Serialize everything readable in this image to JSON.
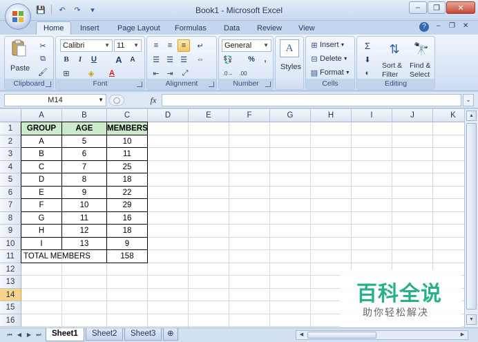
{
  "window": {
    "title": "Book1 - Microsoft Excel",
    "controls": {
      "minimize": "–",
      "restore": "❐",
      "close": "✕"
    }
  },
  "quick_access": {
    "save": "💾",
    "undo": "↶",
    "redo": "↷",
    "customize": "▾"
  },
  "ribbon_tabs": [
    {
      "label": "Home",
      "active": true
    },
    {
      "label": "Insert"
    },
    {
      "label": "Page Layout"
    },
    {
      "label": "Formulas"
    },
    {
      "label": "Data"
    },
    {
      "label": "Review"
    },
    {
      "label": "View"
    }
  ],
  "ribbon": {
    "clipboard": {
      "label": "Clipboard",
      "paste": "Paste"
    },
    "font": {
      "label": "Font",
      "name": "Calibri",
      "size": "11",
      "bold": "B",
      "italic": "I",
      "underline": "U"
    },
    "alignment": {
      "label": "Alignment"
    },
    "number": {
      "label": "Number",
      "format": "General",
      "percent": "%",
      "comma": ","
    },
    "styles": {
      "label": "Styles"
    },
    "cells": {
      "label": "Cells",
      "insert": "Insert",
      "delete": "Delete",
      "format": "Format"
    },
    "editing": {
      "label": "Editing",
      "sort_filter": "Sort &",
      "sort_filter2": "Filter",
      "find_select": "Find &",
      "find_select2": "Select"
    }
  },
  "formula_bar": {
    "name_box": "M14",
    "fx": "fx",
    "formula": ""
  },
  "columns": [
    "A",
    "B",
    "C",
    "D",
    "E",
    "F",
    "G",
    "H",
    "I",
    "J",
    "K"
  ],
  "rows": [
    "1",
    "2",
    "3",
    "4",
    "5",
    "6",
    "7",
    "8",
    "9",
    "10",
    "11",
    "12",
    "13",
    "14",
    "15",
    "16"
  ],
  "selected_row": "14",
  "table": {
    "headers": [
      "GROUP",
      "AGE",
      "MEMBERS"
    ],
    "rows": [
      [
        "A",
        "5",
        "10"
      ],
      [
        "B",
        "6",
        "11"
      ],
      [
        "C",
        "7",
        "25"
      ],
      [
        "D",
        "8",
        "18"
      ],
      [
        "E",
        "9",
        "22"
      ],
      [
        "F",
        "10",
        "29"
      ],
      [
        "G",
        "11",
        "16"
      ],
      [
        "H",
        "12",
        "18"
      ],
      [
        "I",
        "13",
        "9"
      ]
    ],
    "total_label": "TOTAL MEMBERS",
    "total_value": "158"
  },
  "sheet_tabs": [
    "Sheet1",
    "Sheet2",
    "Sheet3"
  ],
  "active_sheet": "Sheet1",
  "watermark": {
    "main": "百科全说",
    "sub": "助你轻松解决"
  },
  "colors": {
    "header_fill": "#ccebcb",
    "selected_row": "#f8d38a",
    "watermark_green": "#27b08a"
  }
}
